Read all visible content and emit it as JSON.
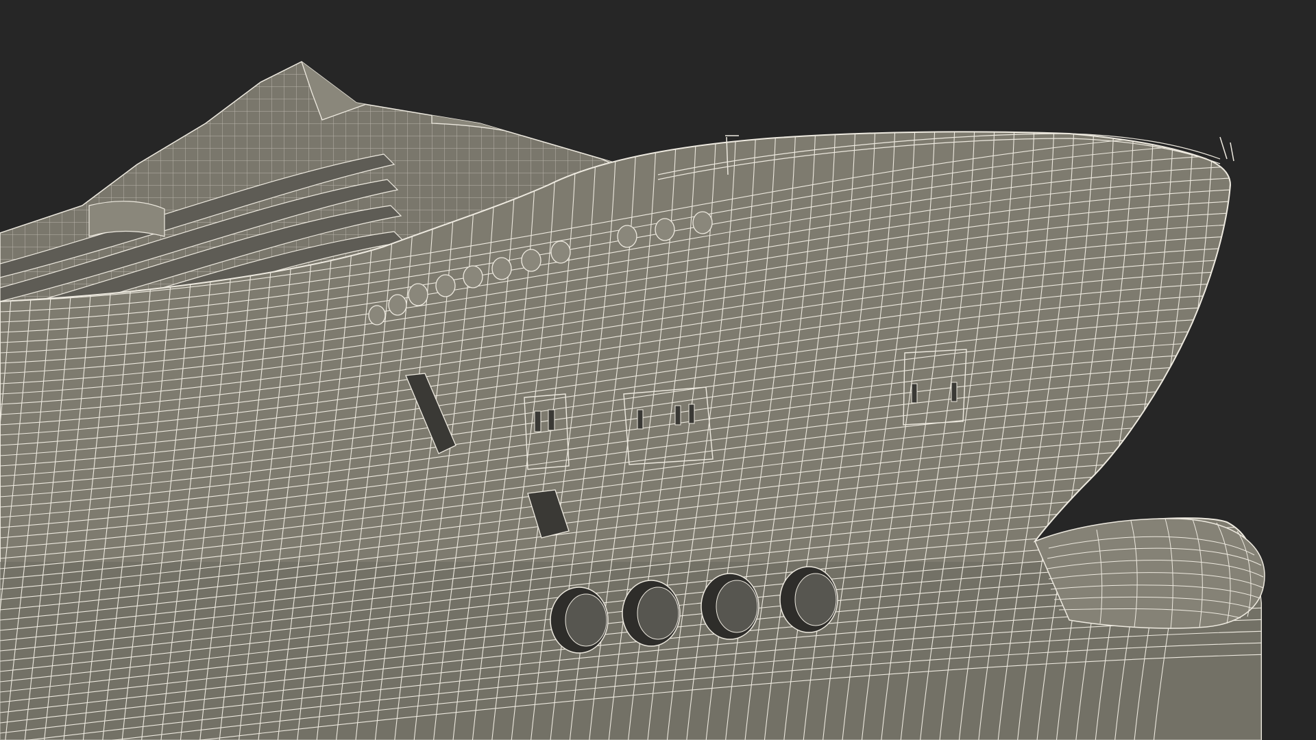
{
  "scene": {
    "subject": "wireframe-render",
    "colors": {
      "background": "#262626",
      "hull": "#7e7b6f",
      "hull_dark": "#6d6a60",
      "hull_light": "#8f8c80",
      "lifeboat": "#e6e3d6",
      "wire": "#eeeae0",
      "opening": "#3a3935",
      "opening_inner": "#575650"
    }
  }
}
